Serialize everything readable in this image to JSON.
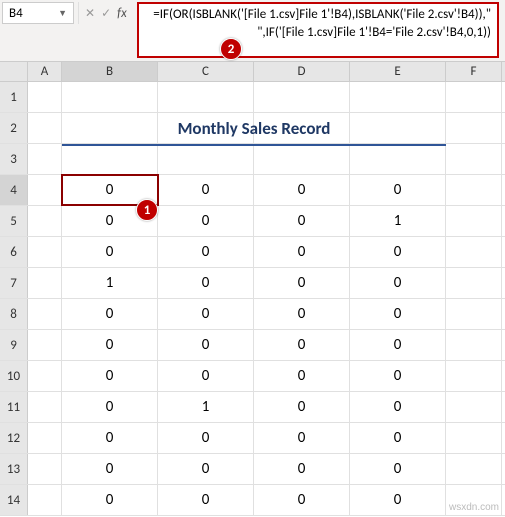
{
  "name_box": "B4",
  "formula": "=IF(OR(ISBLANK('[File 1.csv]File 1'!B4),ISBLANK('File 2.csv'!B4)),\"  \",IF('[File 1.csv]File 1'!B4='File 2.csv'!B4,0,1))",
  "callouts": {
    "one": "1",
    "two": "2"
  },
  "columns": [
    "A",
    "B",
    "C",
    "D",
    "E",
    "F"
  ],
  "rows": [
    "1",
    "2",
    "3",
    "4",
    "5",
    "6",
    "7",
    "8",
    "9",
    "10",
    "11",
    "12",
    "13",
    "14"
  ],
  "title": "Monthly Sales Record",
  "selected_cell": {
    "row": "4",
    "col": "B"
  },
  "chart_data": {
    "type": "table",
    "title": "Monthly Sales Record",
    "columns": [
      "B",
      "C",
      "D",
      "E"
    ],
    "rows_start": 4,
    "values": [
      [
        0,
        0,
        0,
        0
      ],
      [
        0,
        0,
        0,
        1
      ],
      [
        0,
        0,
        0,
        0
      ],
      [
        1,
        0,
        0,
        0
      ],
      [
        0,
        0,
        0,
        0
      ],
      [
        0,
        0,
        0,
        0
      ],
      [
        0,
        0,
        0,
        0
      ],
      [
        0,
        1,
        0,
        0
      ],
      [
        0,
        0,
        0,
        0
      ],
      [
        0,
        0,
        0,
        0
      ],
      [
        0,
        0,
        0,
        0
      ]
    ]
  },
  "watermark": "wsxdn.com"
}
